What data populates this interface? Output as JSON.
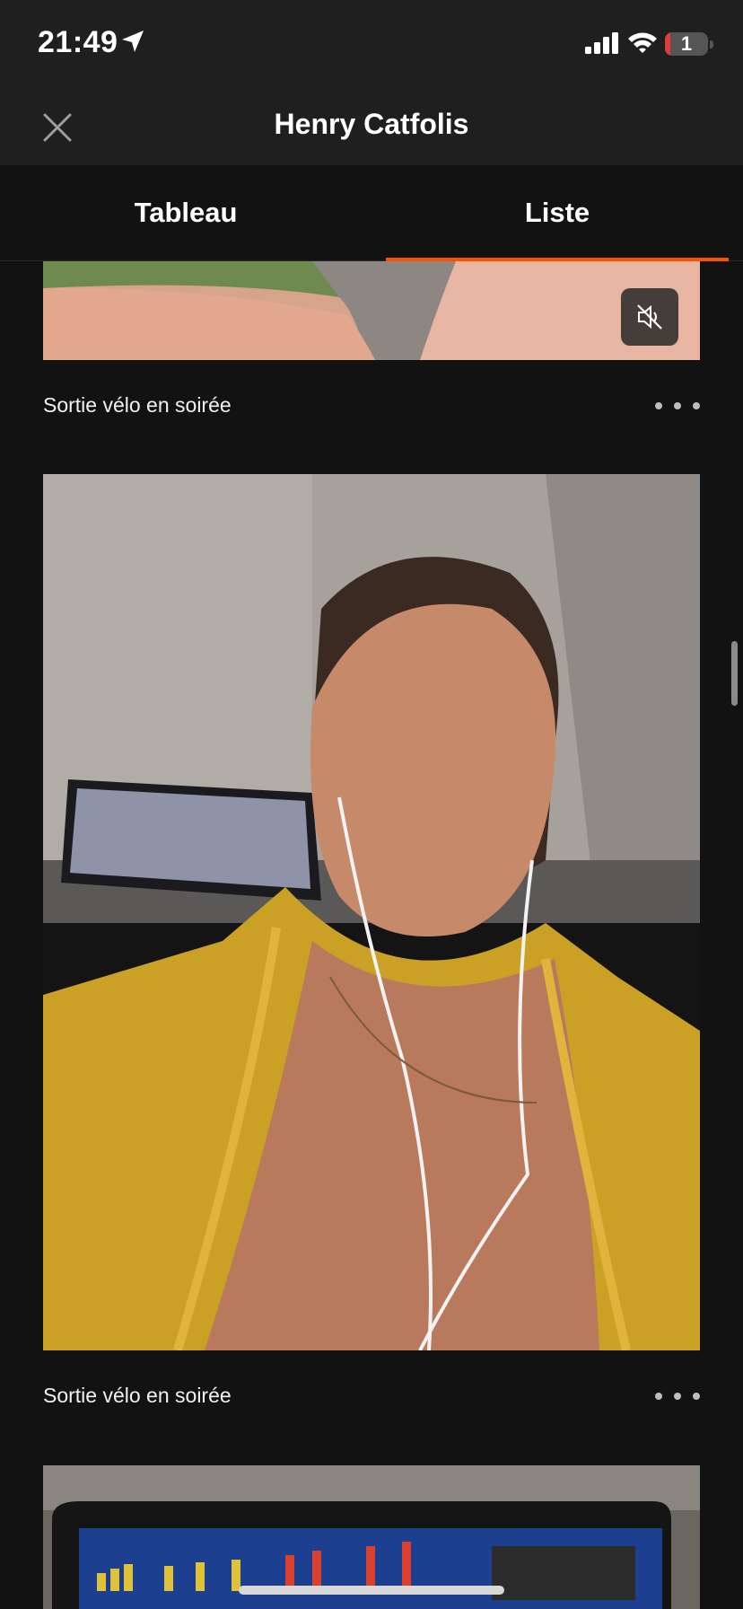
{
  "status_bar": {
    "time": "21:49",
    "battery_level": "1",
    "icons": [
      "location-arrow-icon",
      "cellular-signal-icon",
      "wifi-icon",
      "battery-icon"
    ]
  },
  "header": {
    "title": "Henry Catfolis",
    "close_icon": "close-icon"
  },
  "tabs": [
    {
      "label": "Tableau",
      "selected": false
    },
    {
      "label": "Liste",
      "selected": true
    }
  ],
  "colors": {
    "accent": "#fc5200",
    "background": "#121212",
    "header_background": "#1f1f1f"
  },
  "feed": [
    {
      "caption": "Sortie vélo en soirée",
      "media": "photo",
      "muted_icon": "volume-muted-icon"
    },
    {
      "caption": "Sortie vélo en soirée",
      "media": "photo"
    },
    {
      "media": "photo"
    }
  ]
}
